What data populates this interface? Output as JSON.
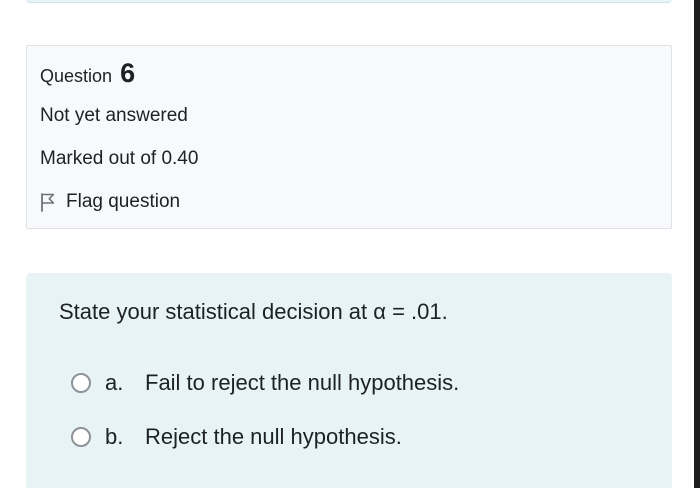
{
  "question_info": {
    "label": "Question",
    "number": "6",
    "state": "Not yet answered",
    "grade": "Marked out of 0.40",
    "flag_label": "Flag question"
  },
  "question": {
    "text": "State your statistical decision at α = .01.",
    "answers": [
      {
        "letter": "a.",
        "text": "Fail to reject the null hypothesis.",
        "selected": false
      },
      {
        "letter": "b.",
        "text": "Reject the null hypothesis.",
        "selected": false
      }
    ]
  },
  "icons": {
    "flag": "flag-outline-icon",
    "radio": "radio-unchecked-icon"
  },
  "colors": {
    "info_background": "#f8f9fa",
    "info_border": "#dee2e6",
    "question_background": "#e7f3f5",
    "text": "#1d2125",
    "radio_border": "#8d9399"
  }
}
